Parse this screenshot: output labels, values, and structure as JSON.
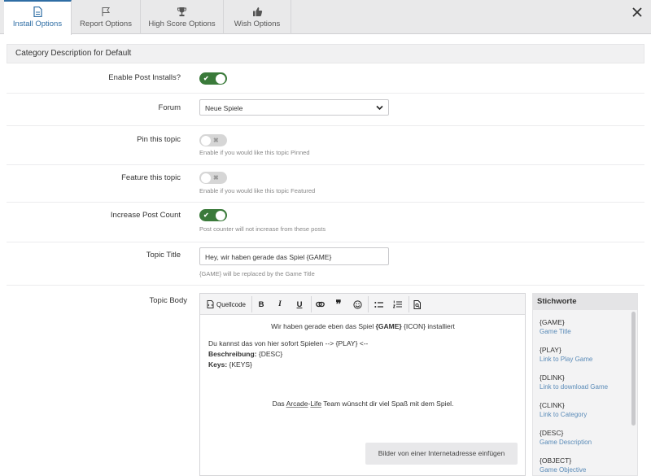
{
  "tabs": [
    {
      "label": "Install Options",
      "icon": "document-icon",
      "active": true
    },
    {
      "label": "Report Options",
      "icon": "flag-icon",
      "active": false
    },
    {
      "label": "High Score Options",
      "icon": "trophy-icon",
      "active": false
    },
    {
      "label": "Wish Options",
      "icon": "thumbs-up-icon",
      "active": false
    }
  ],
  "section_title": "Category Description for Default",
  "fields": {
    "enable_post_installs": {
      "label": "Enable Post Installs?",
      "on": true
    },
    "forum": {
      "label": "Forum",
      "value": "Neue Spiele"
    },
    "pin_topic": {
      "label": "Pin this topic",
      "on": false,
      "help": "Enable if you would like this topic Pinned"
    },
    "feature_topic": {
      "label": "Feature this topic",
      "on": false,
      "help": "Enable if you would like this topic Featured"
    },
    "increase_post_count": {
      "label": "Increase Post Count",
      "on": true,
      "help": "Post counter will not increase from these posts"
    },
    "topic_title": {
      "label": "Topic Title",
      "value": "Hey, wir haben gerade das Spiel {GAME}",
      "help": "{GAME} will be replaced by the Game Title"
    },
    "topic_body": {
      "label": "Topic Body"
    }
  },
  "editor": {
    "toolbar": {
      "source_label": "Quellcode",
      "bold": "B",
      "italic": "I",
      "underline": "U",
      "quote": "❞"
    },
    "content": {
      "line1_pre": "Wir haben gerade eben das Spiel ",
      "line1_bold": "{GAME}",
      "line1_post": " {ICON} installiert",
      "line2": "Du kannst das von hier sofort Spielen  --> {PLAY} <--",
      "line3_bold": "Beschreibung:",
      "line3_rest": " {DESC}",
      "line4_bold": "Keys:",
      "line4_rest": " {KEYS}",
      "line5_pre": "Das ",
      "line5_u1": "Arcade",
      "line5_dash": "-",
      "line5_u2": "Life",
      "line5_post": " Team wünscht dir viel Spaß mit dem Spiel."
    },
    "image_button": "Bilder von einer Internetadresse einfügen"
  },
  "keywords": {
    "title": "Stichworte",
    "items": [
      {
        "key": "{GAME}",
        "desc": "Game Title"
      },
      {
        "key": "{PLAY}",
        "desc": "Link to Play Game"
      },
      {
        "key": "{DLINK}",
        "desc": "Link to download Game"
      },
      {
        "key": "{CLINK}",
        "desc": "Link to Category"
      },
      {
        "key": "{DESC}",
        "desc": "Game Description"
      },
      {
        "key": "{OBJECT}",
        "desc": "Game Objective"
      }
    ]
  },
  "colors": {
    "accent": "#2e6da4",
    "toggle_on": "#3a7a3a",
    "keyword_desc": "#5a8bb8"
  }
}
